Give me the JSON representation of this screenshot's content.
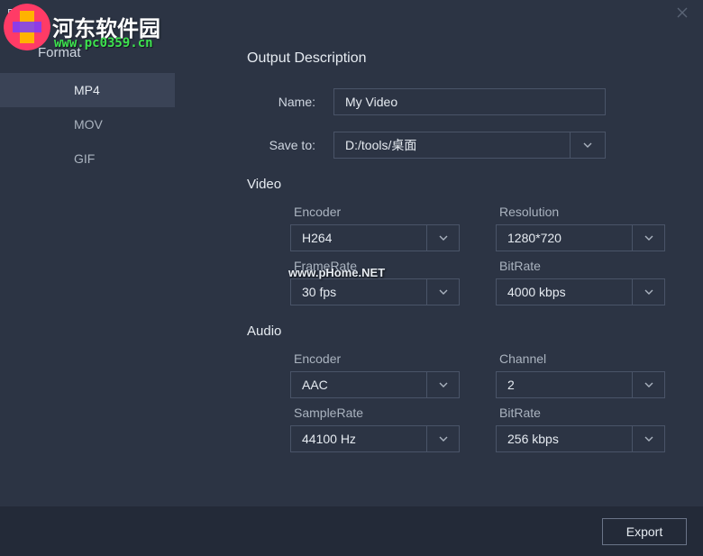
{
  "window": {
    "title": "Export"
  },
  "sidebar": {
    "heading": "Format",
    "items": [
      {
        "label": "MP4",
        "active": true
      },
      {
        "label": "MOV",
        "active": false
      },
      {
        "label": "GIF",
        "active": false
      }
    ]
  },
  "output": {
    "heading": "Output Description",
    "name_label": "Name:",
    "name_value": "My Video",
    "saveto_label": "Save to:",
    "saveto_value": "D:/tools/桌面"
  },
  "video": {
    "heading": "Video",
    "encoder_label": "Encoder",
    "encoder_value": "H264",
    "resolution_label": "Resolution",
    "resolution_value": "1280*720",
    "framerate_label": "FrameRate",
    "framerate_value": "30 fps",
    "bitrate_label": "BitRate",
    "bitrate_value": "4000 kbps"
  },
  "audio": {
    "heading": "Audio",
    "encoder_label": "Encoder",
    "encoder_value": "AAC",
    "channel_label": "Channel",
    "channel_value": "2",
    "samplerate_label": "SampleRate",
    "samplerate_value": "44100 Hz",
    "bitrate_label": "BitRate",
    "bitrate_value": "256 kbps"
  },
  "footer": {
    "export_label": "Export"
  },
  "watermark": {
    "brand": "河东软件园",
    "url": "www.pc0359.cn",
    "center": "www.pHome.NET"
  }
}
